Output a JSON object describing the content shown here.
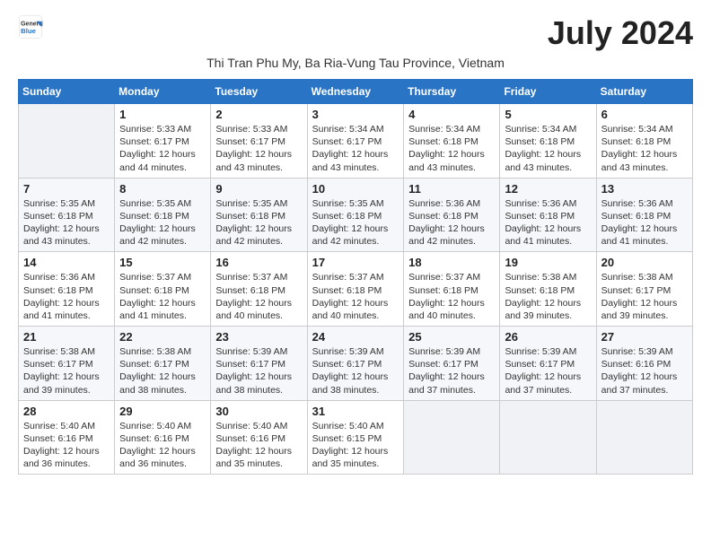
{
  "header": {
    "logo_line1": "General",
    "logo_line2": "Blue",
    "title": "July 2024",
    "subtitle": "Thi Tran Phu My, Ba Ria-Vung Tau Province, Vietnam"
  },
  "columns": [
    "Sunday",
    "Monday",
    "Tuesday",
    "Wednesday",
    "Thursday",
    "Friday",
    "Saturday"
  ],
  "weeks": [
    [
      {
        "day": "",
        "sunrise": "",
        "sunset": "",
        "daylight": ""
      },
      {
        "day": "1",
        "sunrise": "5:33 AM",
        "sunset": "6:17 PM",
        "daylight": "12 hours and 44 minutes."
      },
      {
        "day": "2",
        "sunrise": "5:33 AM",
        "sunset": "6:17 PM",
        "daylight": "12 hours and 43 minutes."
      },
      {
        "day": "3",
        "sunrise": "5:34 AM",
        "sunset": "6:17 PM",
        "daylight": "12 hours and 43 minutes."
      },
      {
        "day": "4",
        "sunrise": "5:34 AM",
        "sunset": "6:18 PM",
        "daylight": "12 hours and 43 minutes."
      },
      {
        "day": "5",
        "sunrise": "5:34 AM",
        "sunset": "6:18 PM",
        "daylight": "12 hours and 43 minutes."
      },
      {
        "day": "6",
        "sunrise": "5:34 AM",
        "sunset": "6:18 PM",
        "daylight": "12 hours and 43 minutes."
      }
    ],
    [
      {
        "day": "7",
        "sunrise": "5:35 AM",
        "sunset": "6:18 PM",
        "daylight": "12 hours and 43 minutes."
      },
      {
        "day": "8",
        "sunrise": "5:35 AM",
        "sunset": "6:18 PM",
        "daylight": "12 hours and 42 minutes."
      },
      {
        "day": "9",
        "sunrise": "5:35 AM",
        "sunset": "6:18 PM",
        "daylight": "12 hours and 42 minutes."
      },
      {
        "day": "10",
        "sunrise": "5:35 AM",
        "sunset": "6:18 PM",
        "daylight": "12 hours and 42 minutes."
      },
      {
        "day": "11",
        "sunrise": "5:36 AM",
        "sunset": "6:18 PM",
        "daylight": "12 hours and 42 minutes."
      },
      {
        "day": "12",
        "sunrise": "5:36 AM",
        "sunset": "6:18 PM",
        "daylight": "12 hours and 41 minutes."
      },
      {
        "day": "13",
        "sunrise": "5:36 AM",
        "sunset": "6:18 PM",
        "daylight": "12 hours and 41 minutes."
      }
    ],
    [
      {
        "day": "14",
        "sunrise": "5:36 AM",
        "sunset": "6:18 PM",
        "daylight": "12 hours and 41 minutes."
      },
      {
        "day": "15",
        "sunrise": "5:37 AM",
        "sunset": "6:18 PM",
        "daylight": "12 hours and 41 minutes."
      },
      {
        "day": "16",
        "sunrise": "5:37 AM",
        "sunset": "6:18 PM",
        "daylight": "12 hours and 40 minutes."
      },
      {
        "day": "17",
        "sunrise": "5:37 AM",
        "sunset": "6:18 PM",
        "daylight": "12 hours and 40 minutes."
      },
      {
        "day": "18",
        "sunrise": "5:37 AM",
        "sunset": "6:18 PM",
        "daylight": "12 hours and 40 minutes."
      },
      {
        "day": "19",
        "sunrise": "5:38 AM",
        "sunset": "6:18 PM",
        "daylight": "12 hours and 39 minutes."
      },
      {
        "day": "20",
        "sunrise": "5:38 AM",
        "sunset": "6:17 PM",
        "daylight": "12 hours and 39 minutes."
      }
    ],
    [
      {
        "day": "21",
        "sunrise": "5:38 AM",
        "sunset": "6:17 PM",
        "daylight": "12 hours and 39 minutes."
      },
      {
        "day": "22",
        "sunrise": "5:38 AM",
        "sunset": "6:17 PM",
        "daylight": "12 hours and 38 minutes."
      },
      {
        "day": "23",
        "sunrise": "5:39 AM",
        "sunset": "6:17 PM",
        "daylight": "12 hours and 38 minutes."
      },
      {
        "day": "24",
        "sunrise": "5:39 AM",
        "sunset": "6:17 PM",
        "daylight": "12 hours and 38 minutes."
      },
      {
        "day": "25",
        "sunrise": "5:39 AM",
        "sunset": "6:17 PM",
        "daylight": "12 hours and 37 minutes."
      },
      {
        "day": "26",
        "sunrise": "5:39 AM",
        "sunset": "6:17 PM",
        "daylight": "12 hours and 37 minutes."
      },
      {
        "day": "27",
        "sunrise": "5:39 AM",
        "sunset": "6:16 PM",
        "daylight": "12 hours and 37 minutes."
      }
    ],
    [
      {
        "day": "28",
        "sunrise": "5:40 AM",
        "sunset": "6:16 PM",
        "daylight": "12 hours and 36 minutes."
      },
      {
        "day": "29",
        "sunrise": "5:40 AM",
        "sunset": "6:16 PM",
        "daylight": "12 hours and 36 minutes."
      },
      {
        "day": "30",
        "sunrise": "5:40 AM",
        "sunset": "6:16 PM",
        "daylight": "12 hours and 35 minutes."
      },
      {
        "day": "31",
        "sunrise": "5:40 AM",
        "sunset": "6:15 PM",
        "daylight": "12 hours and 35 minutes."
      },
      {
        "day": "",
        "sunrise": "",
        "sunset": "",
        "daylight": ""
      },
      {
        "day": "",
        "sunrise": "",
        "sunset": "",
        "daylight": ""
      },
      {
        "day": "",
        "sunrise": "",
        "sunset": "",
        "daylight": ""
      }
    ]
  ]
}
